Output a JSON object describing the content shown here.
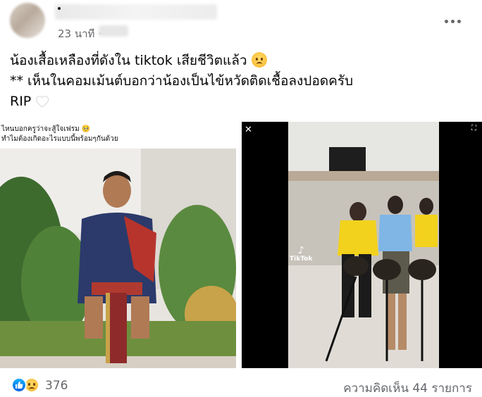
{
  "header": {
    "timestamp": "23 นาที ·",
    "more_icon": "more-horizontal-icon"
  },
  "post": {
    "line1": "น้องเสื้อเหลืองที่ดังใน tiktok เสียชีวิตแล้ว",
    "line2": "** เห็นในคอมเม้นต์บอกว่าน้องเป็นไข้หวัดติดเชื้อลงปอดครับ",
    "line3": "RIP",
    "emoji1": "sad-face-icon",
    "emoji2": "white-heart-icon"
  },
  "left_image": {
    "caption_line1": "ไหนบอกครูว่าจะสู้ใจเฟรม 🥺",
    "caption_line2": "ทำไมต้องเกิดอะไรแบบนี้พร้อมๆกันด้วย"
  },
  "right_image": {
    "watermark": "TikTok",
    "close_icon": "close-icon",
    "expand_icon": "expand-icon"
  },
  "footer": {
    "reaction_count": "376",
    "comment_count": "ความคิดเห็น 44 รายการ",
    "reactions": [
      "like-icon",
      "sad-icon"
    ]
  },
  "colors": {
    "secondary_text": "#65676b",
    "like_blue": "#0062df",
    "shirt_yellow": "#f2d21c"
  }
}
